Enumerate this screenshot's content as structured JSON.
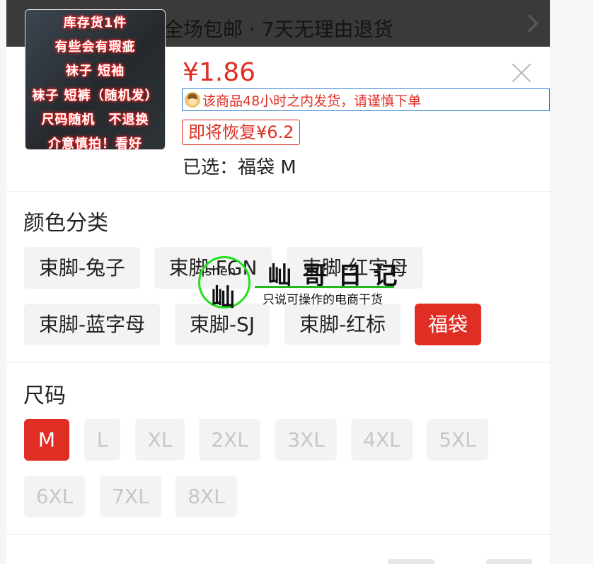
{
  "topbar": {
    "shipping_text": "全场包邮 · 7天无理由退货"
  },
  "product": {
    "thumbnail_lines": [
      "库存货1件",
      "有些会有瑕疵",
      "袜子 短袖",
      "袜子 短裤（随机发）",
      "尺码随机　不退换",
      "介意慎拍！看好"
    ],
    "price": "¥1.86",
    "notice": "该商品48小时之内发货，请谨慎下单",
    "restore_price": "即将恢复¥6.2",
    "selected": "已选：福袋 M"
  },
  "color_section": {
    "title": "颜色分类",
    "options": [
      "束脚-兔子",
      "束脚-FGN",
      "束脚-红字母",
      "束脚-蓝字母",
      "束脚-SJ",
      "束脚-红标",
      "福袋"
    ],
    "selected": "福袋"
  },
  "size_section": {
    "title": "尺码",
    "options": [
      "M",
      "L",
      "XL",
      "2XL",
      "3XL",
      "4XL",
      "5XL",
      "6XL",
      "7XL",
      "8XL"
    ],
    "selected": "M"
  },
  "watermark": {
    "circle_small_text": "shen",
    "circle_char": "屾",
    "title": "屾 哥 日 记",
    "subtitle": "只说可操作的电商干货"
  },
  "colors": {
    "accent": "#e02e24",
    "watermark_green": "#22e01c",
    "notice_border": "#2f7fd6"
  }
}
